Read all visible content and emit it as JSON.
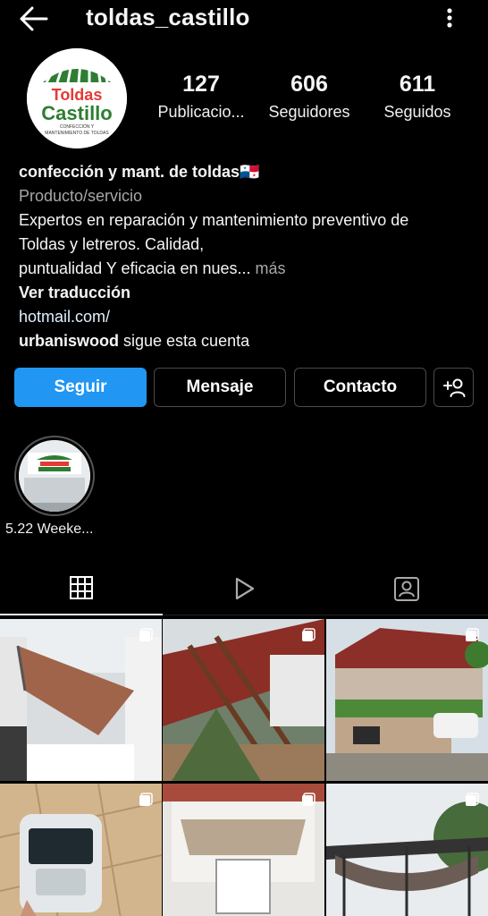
{
  "header": {
    "username": "toldas_castillo",
    "back_icon": "arrow-left-icon",
    "more_icon": "more-vertical-icon"
  },
  "avatar": {
    "line1": "Toldas",
    "line2": "Castillo",
    "line3": "CONFECCIÓN Y",
    "line4": "MANTENIMIENTO DE TOLDAS"
  },
  "stats": {
    "posts": {
      "value": "127",
      "label": "Publicacio..."
    },
    "followers": {
      "value": "606",
      "label": "Seguidores"
    },
    "following": {
      "value": "611",
      "label": "Seguidos"
    }
  },
  "bio": {
    "name": "confección y mant. de toldas🇵🇦",
    "category": "Producto/servicio",
    "text_line1": "Expertos en reparación  y mantenimiento preventivo de",
    "text_line2": "Toldas y letreros. Calidad,",
    "text_line3": " puntualidad Y eficacia en nues...",
    "more": " más",
    "translate": "Ver traducción",
    "link": "hotmail.com/",
    "followed_by_user": "urbaniswood",
    "followed_by_text": " sigue esta cuenta"
  },
  "actions": {
    "follow": "Seguir",
    "message": "Mensaje",
    "contact": "Contacto",
    "add_user_icon": "add-user-icon"
  },
  "highlights": [
    {
      "label": "5.22 Weeke..."
    }
  ],
  "tabs": [
    {
      "name": "grid",
      "icon": "grid-icon",
      "active": true
    },
    {
      "name": "reels",
      "icon": "play-icon",
      "active": false
    },
    {
      "name": "tagged",
      "icon": "tagged-user-icon",
      "active": false
    }
  ],
  "colors": {
    "background": "#000000",
    "accent": "#2196f3",
    "secondary_text": "#a8a8a8",
    "link_text": "#e0f1ff"
  }
}
